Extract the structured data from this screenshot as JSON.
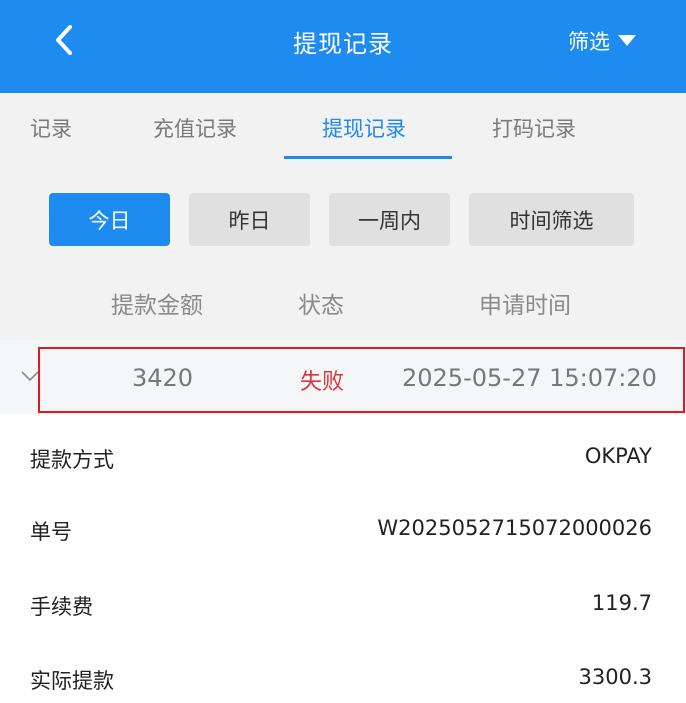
{
  "header": {
    "title": "提现记录",
    "filter_label": "筛选"
  },
  "tabs": [
    {
      "label": "记录",
      "active": false
    },
    {
      "label": "充值记录",
      "active": false
    },
    {
      "label": "提现记录",
      "active": true
    },
    {
      "label": "打码记录",
      "active": false
    }
  ],
  "date_filters": [
    {
      "label": "今日",
      "active": true
    },
    {
      "label": "昨日",
      "active": false
    },
    {
      "label": "一周内",
      "active": false
    },
    {
      "label": "时间筛选",
      "active": false
    }
  ],
  "columns": {
    "amount": "提款金额",
    "status": "状态",
    "time": "申请时间"
  },
  "record": {
    "amount": "3420",
    "status": "失败",
    "time": "2025-05-27 15:07:20",
    "details": [
      {
        "label": "提款方式",
        "value": "OKPAY"
      },
      {
        "label": "单号",
        "value": "W2025052715072000026"
      },
      {
        "label": "手续费",
        "value": "119.7"
      },
      {
        "label": "实际提款",
        "value": "3300.3"
      }
    ]
  },
  "colors": {
    "primary": "#1e8bf0",
    "status_failed": "#d9363e",
    "highlight_border": "#e01a1a"
  }
}
